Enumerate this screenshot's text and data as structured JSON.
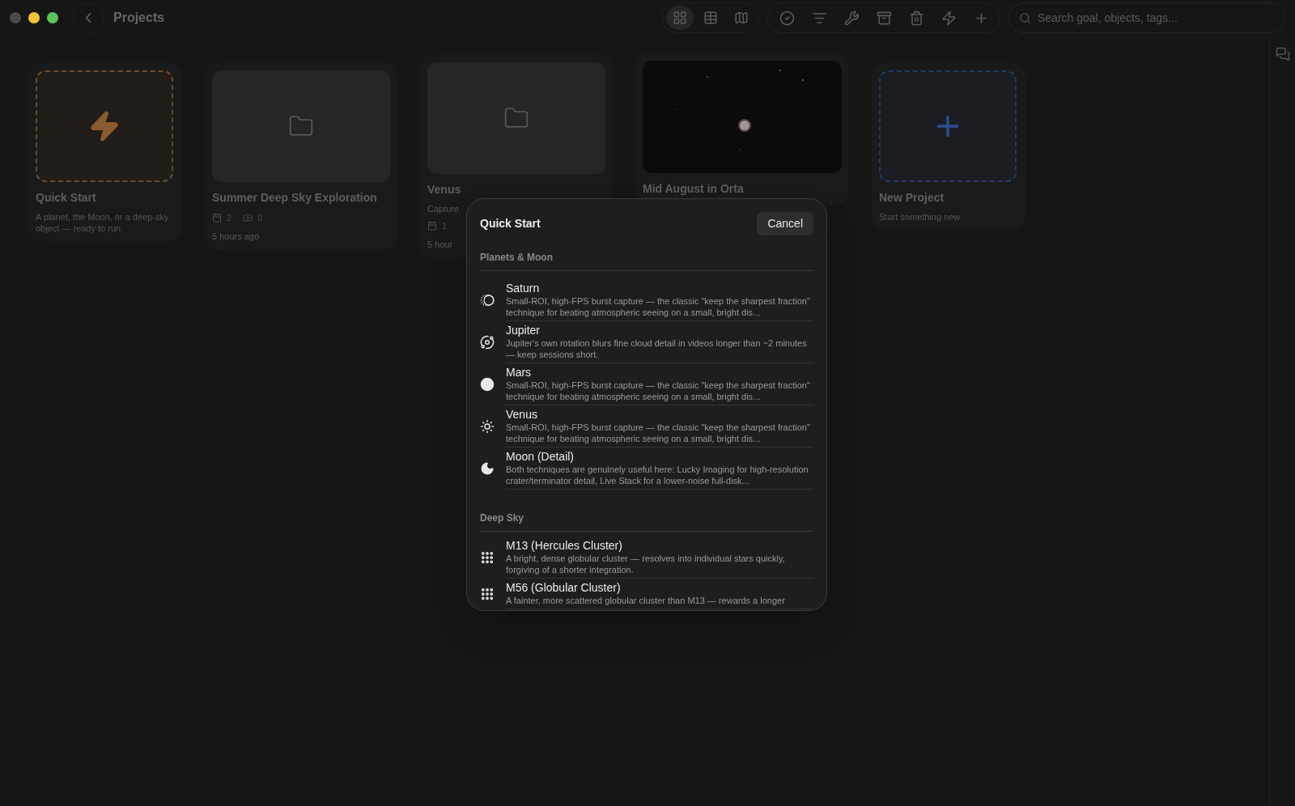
{
  "window": {
    "title": "Projects"
  },
  "view_buttons": [
    {
      "kind": "grid",
      "selected": true
    },
    {
      "kind": "table",
      "selected": false
    },
    {
      "kind": "map",
      "selected": false
    }
  ],
  "action_buttons": [
    {
      "kind": "check"
    },
    {
      "kind": "filter"
    },
    {
      "kind": "tools"
    },
    {
      "kind": "archive"
    },
    {
      "kind": "trash"
    },
    {
      "kind": "bolt"
    },
    {
      "kind": "plus"
    }
  ],
  "search": {
    "placeholder": "Search goal, objects, tags..."
  },
  "cards": [
    {
      "kind": "quickstart",
      "title": "Quick Start",
      "subtitle": "A planet, the Moon, or a deep-sky object — ready to run"
    },
    {
      "kind": "folder",
      "title": "Summer Deep Sky Exploration",
      "sessions": "2",
      "photos": "0",
      "updated": "5 hours ago"
    },
    {
      "kind": "folder",
      "title": "Venus",
      "subtitle": "Capture",
      "sessions": "1",
      "updated": "5 hour"
    },
    {
      "title": "Mid August in Orta"
    },
    {
      "kind": "new",
      "title": "New Project",
      "subtitle": "Start something new"
    }
  ],
  "dialog": {
    "title": "Quick Start",
    "cancel": "Cancel",
    "sections": [
      {
        "title": "Planets & Moon",
        "items": [
          {
            "kind": "saturn",
            "name": "Saturn",
            "description": "Small-ROI, high-FPS burst capture — the classic \"keep the sharpest fraction\" technique for beating atmospheric seeing on a small, bright dis..."
          },
          {
            "kind": "jupiter",
            "name": "Jupiter",
            "description": "Jupiter's own rotation blurs fine cloud detail in videos longer than ~2 minutes — keep sessions short."
          },
          {
            "kind": "mars",
            "name": "Mars",
            "description": "Small-ROI, high-FPS burst capture — the classic \"keep the sharpest fraction\" technique for beating atmospheric seeing on a small, bright dis..."
          },
          {
            "kind": "venus",
            "name": "Venus",
            "description": "Small-ROI, high-FPS burst capture — the classic \"keep the sharpest fraction\" technique for beating atmospheric seeing on a small, bright dis..."
          },
          {
            "kind": "moon",
            "name": "Moon (Detail)",
            "description": "Both techniques are genuinely useful here: Lucky Imaging for high-resolution crater/terminator detail, Live Stack for a lower-noise full-disk..."
          }
        ]
      },
      {
        "title": "Deep Sky",
        "items": [
          {
            "kind": "cluster",
            "name": "M13 (Hercules Cluster)",
            "description": "A bright, dense globular cluster — resolves into individual stars quickly, forgiving of a shorter integration."
          },
          {
            "kind": "cluster",
            "name": "M56 (Globular Cluster)",
            "description": "A fainter, more scattered globular cluster than M13 — rewards a longer"
          }
        ]
      }
    ]
  }
}
